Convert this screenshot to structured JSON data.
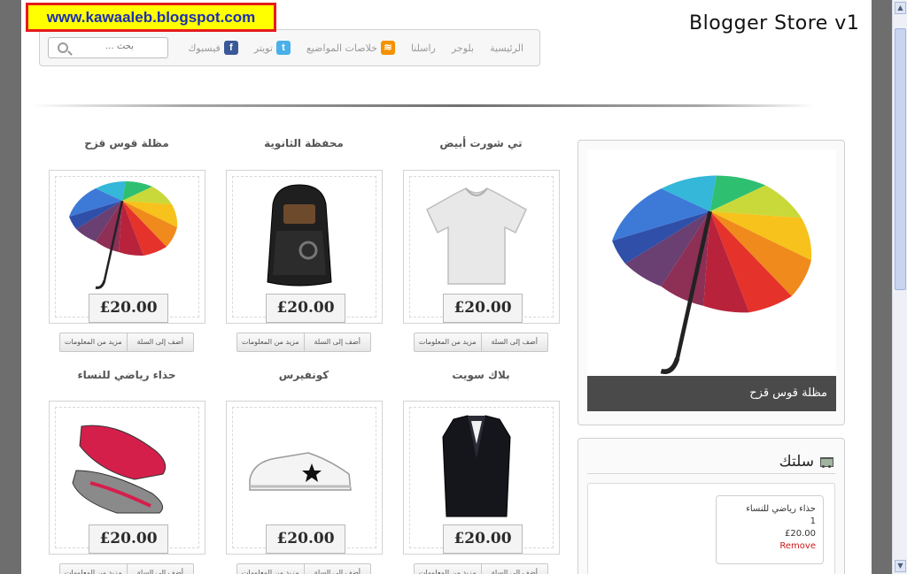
{
  "watermark": "www.kawaaleb.blogspot.com",
  "store_title": "Blogger Store v1",
  "nav": {
    "items": [
      "الرئيسية",
      "بلوجر",
      "راسلنا",
      "خلاصات المواضيع",
      "تويتر",
      "فيسبوك"
    ],
    "search_placeholder": "بحث ..."
  },
  "products": [
    {
      "title": "تي شورت أبيض",
      "price": "£20.00",
      "image": "white-tshirt"
    },
    {
      "title": "محفظة الثانوية",
      "price": "£20.00",
      "image": "black-backpack"
    },
    {
      "title": "مظلة قوس قزح",
      "price": "£20.00",
      "image": "rainbow-umbrella"
    },
    {
      "title": "بلاك سويت",
      "price": "£20.00",
      "image": "black-suit"
    },
    {
      "title": "كونفيرس",
      "price": "£20.00",
      "image": "converse-sneaker"
    },
    {
      "title": "حذاء رياضي للنساء",
      "price": "£20.00",
      "image": "running-shoe"
    }
  ],
  "buttons": {
    "add_to_cart": "أضف إلى السلة",
    "more_info": "مزيد من المعلومات"
  },
  "featured": {
    "caption": "مظلة قوس قزح",
    "image": "rainbow-umbrella"
  },
  "cart": {
    "title": "سلتك",
    "item": {
      "name": "حذاء رياضي للنساء",
      "qty": "1",
      "price": "£20.00",
      "remove_label": "Remove"
    }
  },
  "colors": {
    "watermark_bg": "#ffff00",
    "watermark_border": "#e61c1c",
    "watermark_text": "#1d2fb0",
    "remove_red": "#cc1a1a",
    "caption_bg": "#4a4a4a"
  }
}
